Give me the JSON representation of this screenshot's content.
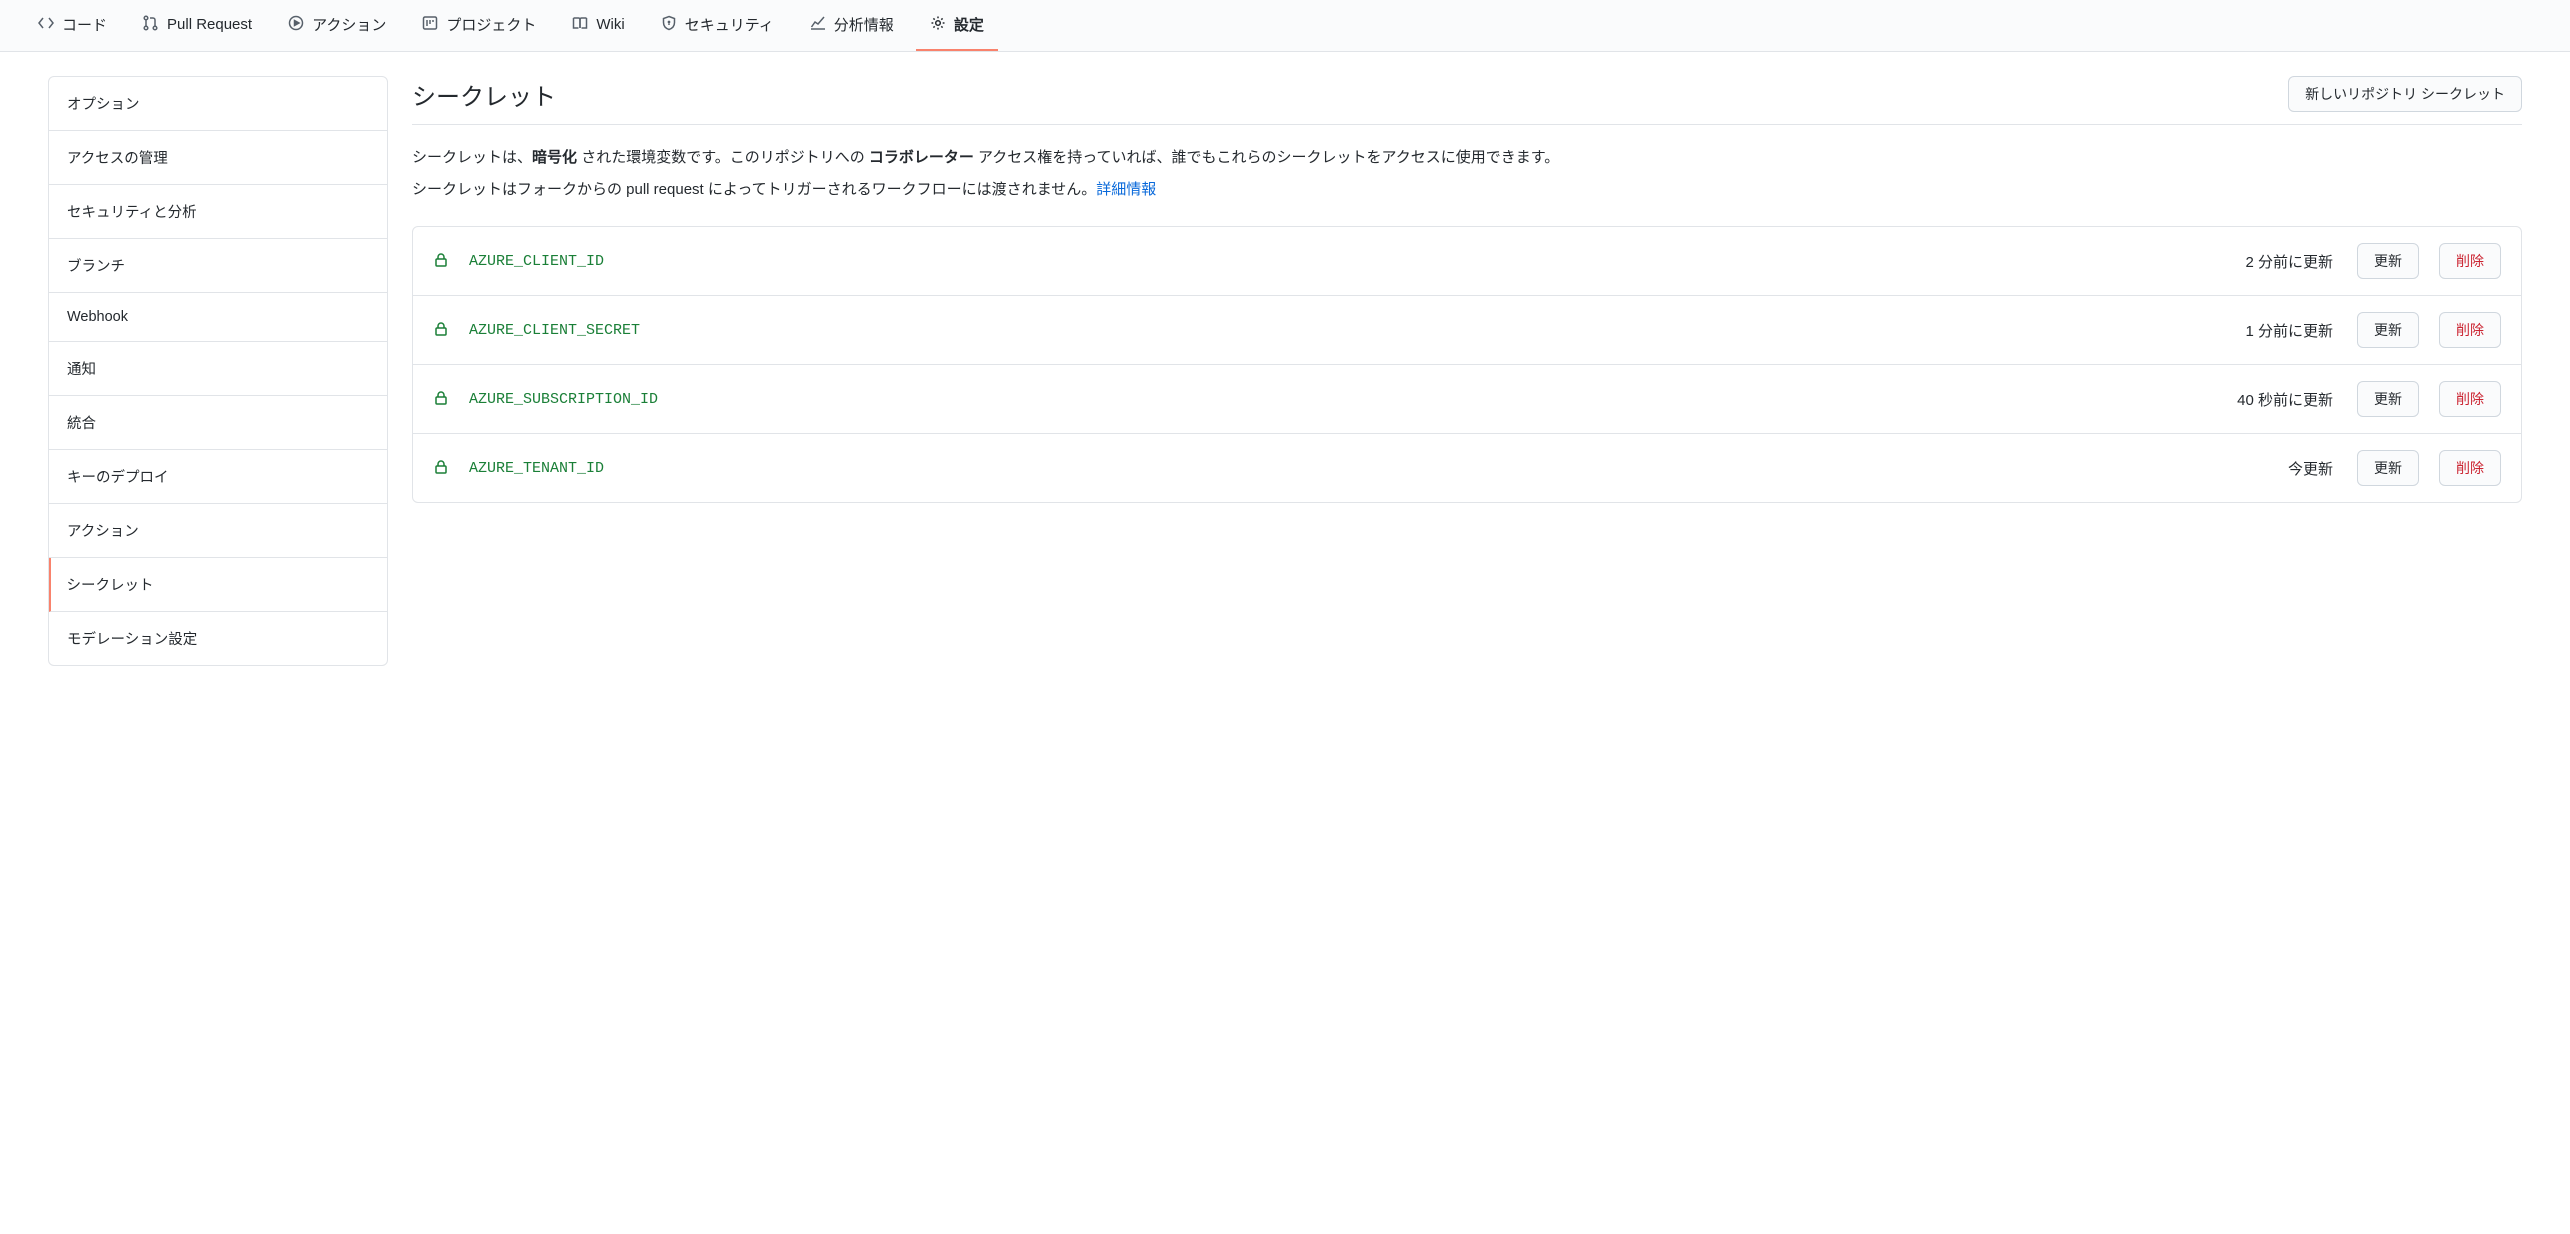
{
  "tabnav": [
    {
      "label": "コード",
      "name": "tab-code",
      "icon": "code"
    },
    {
      "label": "Pull Request",
      "name": "tab-pull-request",
      "icon": "pr"
    },
    {
      "label": "アクション",
      "name": "tab-actions",
      "icon": "play"
    },
    {
      "label": "プロジェクト",
      "name": "tab-projects",
      "icon": "project"
    },
    {
      "label": "Wiki",
      "name": "tab-wiki",
      "icon": "book"
    },
    {
      "label": "セキュリティ",
      "name": "tab-security",
      "icon": "shield"
    },
    {
      "label": "分析情報",
      "name": "tab-insights",
      "icon": "graph"
    },
    {
      "label": "設定",
      "name": "tab-settings",
      "icon": "gear",
      "active": true
    }
  ],
  "sidebar": [
    {
      "label": "オプション",
      "name": "sidebar-options"
    },
    {
      "label": "アクセスの管理",
      "name": "sidebar-access"
    },
    {
      "label": "セキュリティと分析",
      "name": "sidebar-security-analysis"
    },
    {
      "label": "ブランチ",
      "name": "sidebar-branches"
    },
    {
      "label": "Webhook",
      "name": "sidebar-webhook"
    },
    {
      "label": "通知",
      "name": "sidebar-notifications"
    },
    {
      "label": "統合",
      "name": "sidebar-integrations"
    },
    {
      "label": "キーのデプロイ",
      "name": "sidebar-deploy-keys"
    },
    {
      "label": "アクション",
      "name": "sidebar-actions"
    },
    {
      "label": "シークレット",
      "name": "sidebar-secrets",
      "active": true
    },
    {
      "label": "モデレーション設定",
      "name": "sidebar-moderation"
    }
  ],
  "page": {
    "title": "シークレット",
    "new_button": "新しいリポジトリ シークレット",
    "desc1_a": "シークレットは、",
    "desc1_b": "暗号化",
    "desc1_c": " された環境変数です。このリポジトリへの ",
    "desc1_d": "コラボレーター",
    "desc1_e": " アクセス権を持っていれば、誰でもこれらのシークレットをアクセスに使用できます。",
    "desc2_a": "シークレットはフォークからの pull request によってトリガーされるワークフローには渡されません。",
    "desc2_link": "詳細情報",
    "update_label": "更新",
    "delete_label": "削除"
  },
  "secrets": [
    {
      "name": "AZURE_CLIENT_ID",
      "updated": "2 分前に更新"
    },
    {
      "name": "AZURE_CLIENT_SECRET",
      "updated": "1 分前に更新"
    },
    {
      "name": "AZURE_SUBSCRIPTION_ID",
      "updated": "40 秒前に更新"
    },
    {
      "name": "AZURE_TENANT_ID",
      "updated": "今更新"
    }
  ]
}
